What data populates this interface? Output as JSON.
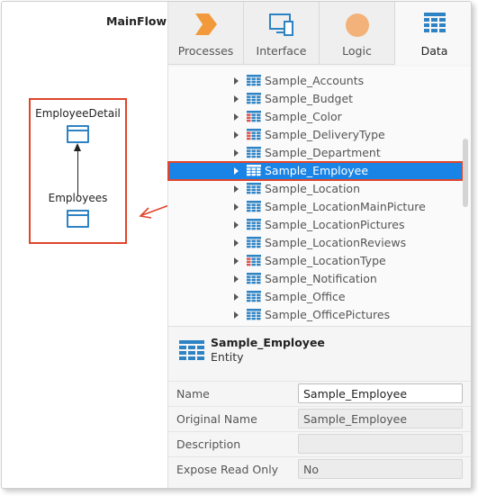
{
  "flow": {
    "title": "MainFlow",
    "nodes": [
      {
        "label": "EmployeeDetail"
      },
      {
        "label": "Employees"
      }
    ]
  },
  "tabs": [
    {
      "label": "Processes",
      "icon": "processes-chevron-icon",
      "color": "#f29a3b"
    },
    {
      "label": "Interface",
      "icon": "interface-screens-icon",
      "color": "#2e83c4"
    },
    {
      "label": "Logic",
      "icon": "logic-circle-icon",
      "color": "#f2b27a"
    },
    {
      "label": "Data",
      "icon": "data-grid-icon",
      "color": "#2e83c4",
      "active": true
    }
  ],
  "tree": {
    "items": [
      {
        "label": "Sample_Accounts",
        "icon": "entity-icon"
      },
      {
        "label": "Sample_Budget",
        "icon": "entity-icon"
      },
      {
        "label": "Sample_Color",
        "icon": "static-entity-icon"
      },
      {
        "label": "Sample_DeliveryType",
        "icon": "static-entity-icon"
      },
      {
        "label": "Sample_Department",
        "icon": "entity-icon"
      },
      {
        "label": "Sample_Employee",
        "icon": "entity-icon",
        "selected": true
      },
      {
        "label": "Sample_Location",
        "icon": "entity-icon"
      },
      {
        "label": "Sample_LocationMainPicture",
        "icon": "entity-icon"
      },
      {
        "label": "Sample_LocationPictures",
        "icon": "entity-icon"
      },
      {
        "label": "Sample_LocationReviews",
        "icon": "entity-icon"
      },
      {
        "label": "Sample_LocationType",
        "icon": "static-entity-icon"
      },
      {
        "label": "Sample_Notification",
        "icon": "entity-icon"
      },
      {
        "label": "Sample_Office",
        "icon": "entity-icon"
      },
      {
        "label": "Sample_OfficePictures",
        "icon": "entity-icon"
      }
    ]
  },
  "properties": {
    "title": "Sample_Employee",
    "subtitle": "Entity",
    "rows": [
      {
        "label": "Name",
        "value": "Sample_Employee",
        "editable": true
      },
      {
        "label": "Original Name",
        "value": "Sample_Employee",
        "editable": false
      },
      {
        "label": "Description",
        "value": "",
        "editable": false
      },
      {
        "label": "Expose Read Only",
        "value": "No",
        "editable": false
      }
    ]
  },
  "colors": {
    "selection": "#1a84e6",
    "highlight_outline": "#e0452b",
    "entity_blue": "#2e83c4",
    "static_entity_red": "#d9534f"
  }
}
